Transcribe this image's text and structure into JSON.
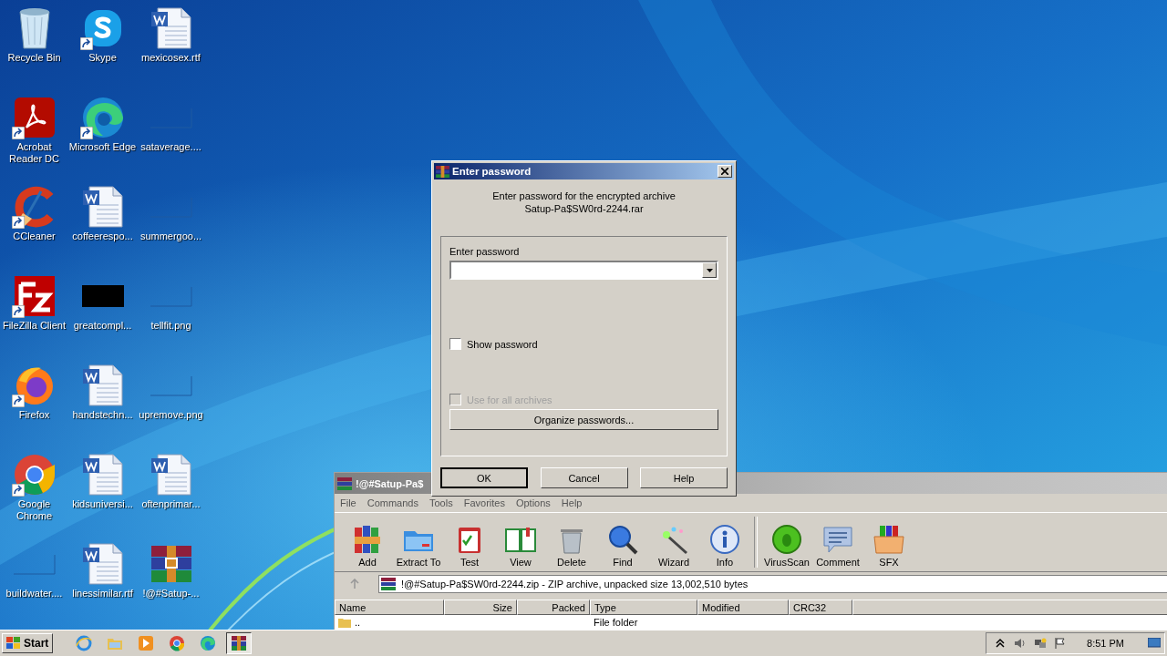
{
  "desktop": {
    "icons": [
      {
        "label": "Recycle Bin",
        "kind": "recycle",
        "shortcut": false
      },
      {
        "label": "Skype",
        "kind": "skype",
        "shortcut": true
      },
      {
        "label": "mexicosex.rtf",
        "kind": "word",
        "shortcut": false
      },
      {
        "label": "Acrobat Reader DC",
        "kind": "acrobat",
        "shortcut": true
      },
      {
        "label": "Microsoft Edge",
        "kind": "edge",
        "shortcut": true
      },
      {
        "label": "sataverage....",
        "kind": "blank",
        "shortcut": false
      },
      {
        "label": "CCleaner",
        "kind": "ccleaner",
        "shortcut": true
      },
      {
        "label": "coffeerespo...",
        "kind": "word",
        "shortcut": false
      },
      {
        "label": "summergoo...",
        "kind": "blank",
        "shortcut": false
      },
      {
        "label": "FileZilla Client",
        "kind": "filezilla",
        "shortcut": true
      },
      {
        "label": "greatcompl...",
        "kind": "dark",
        "shortcut": false
      },
      {
        "label": "tellfit.png",
        "kind": "blank",
        "shortcut": false
      },
      {
        "label": "Firefox",
        "kind": "firefox",
        "shortcut": true
      },
      {
        "label": "handstechn...",
        "kind": "word",
        "shortcut": false
      },
      {
        "label": "upremove.png",
        "kind": "blank",
        "shortcut": false
      },
      {
        "label": "Google Chrome",
        "kind": "chrome",
        "shortcut": true
      },
      {
        "label": "kidsuniversi...",
        "kind": "word",
        "shortcut": false
      },
      {
        "label": "oftenprimar...",
        "kind": "word",
        "shortcut": false
      },
      {
        "label": "buildwater....",
        "kind": "blank",
        "shortcut": false
      },
      {
        "label": "linessimilar.rtf",
        "kind": "word",
        "shortcut": false
      },
      {
        "label": "!@#Satup-...",
        "kind": "archive",
        "shortcut": false
      }
    ]
  },
  "archiver": {
    "title": "!@#Satup-Pa$",
    "menu": [
      "File",
      "Commands",
      "Tools",
      "Favorites",
      "Options",
      "Help"
    ],
    "toolbar": [
      {
        "label": "Add",
        "kind": "add"
      },
      {
        "label": "Extract To",
        "kind": "extract"
      },
      {
        "label": "Test",
        "kind": "test"
      },
      {
        "label": "View",
        "kind": "view"
      },
      {
        "label": "Delete",
        "kind": "delete"
      },
      {
        "label": "Find",
        "kind": "find"
      },
      {
        "label": "Wizard",
        "kind": "wizard"
      },
      {
        "label": "Info",
        "kind": "info"
      },
      {
        "label": "VirusScan",
        "kind": "virus"
      },
      {
        "label": "Comment",
        "kind": "comment"
      },
      {
        "label": "SFX",
        "kind": "sfx"
      }
    ],
    "address": "!@#Satup-Pa$SW0rd-2244.zip - ZIP archive, unpacked size 13,002,510 bytes",
    "columns": [
      "Name",
      "Size",
      "Packed",
      "Type",
      "Modified",
      "CRC32"
    ],
    "rows": [
      {
        "name": "..",
        "type": "File folder"
      }
    ]
  },
  "dialog": {
    "title": "Enter password",
    "message": [
      "Enter password for the encrypted archive",
      "Satup-Pa$SW0rd-2244.rar"
    ],
    "password_label": "Enter password",
    "show_password": {
      "label": "Show password",
      "checked": false,
      "disabled": false
    },
    "use_for_all": {
      "label": "Use for all archives",
      "checked": false,
      "disabled": true
    },
    "organize_button": "Organize passwords...",
    "buttons": [
      {
        "label": "OK",
        "default": true
      },
      {
        "label": "Cancel",
        "default": false
      },
      {
        "label": "Help",
        "default": false
      }
    ]
  },
  "taskbar": {
    "start": "Start",
    "apps": [
      {
        "kind": "ie",
        "selected": false
      },
      {
        "kind": "explorer",
        "selected": false
      },
      {
        "kind": "media",
        "selected": false
      },
      {
        "kind": "chrome",
        "selected": false
      },
      {
        "kind": "edge",
        "selected": false
      },
      {
        "kind": "archive",
        "selected": true
      }
    ],
    "clock": "8:51 PM"
  }
}
